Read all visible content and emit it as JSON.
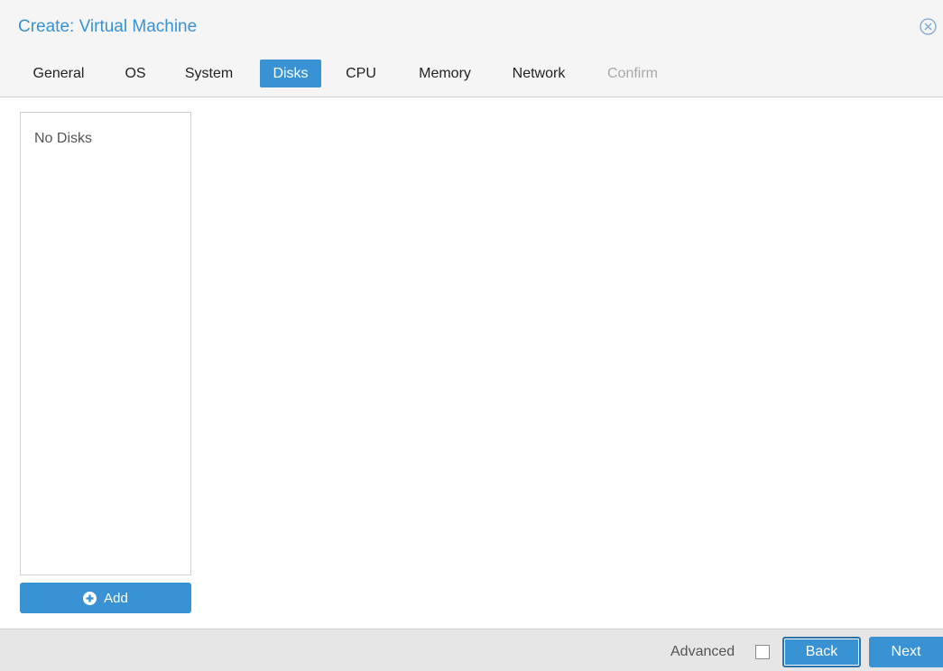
{
  "window": {
    "title": "Create: Virtual Machine"
  },
  "tabs": [
    {
      "label": "General",
      "state": "normal"
    },
    {
      "label": "OS",
      "state": "normal"
    },
    {
      "label": "System",
      "state": "normal"
    },
    {
      "label": "Disks",
      "state": "active"
    },
    {
      "label": "CPU",
      "state": "normal"
    },
    {
      "label": "Memory",
      "state": "normal"
    },
    {
      "label": "Network",
      "state": "normal"
    },
    {
      "label": "Confirm",
      "state": "disabled"
    }
  ],
  "disks": {
    "empty_text": "No Disks",
    "add_label": "Add"
  },
  "footer": {
    "advanced_label": "Advanced",
    "advanced_checked": false,
    "back_label": "Back",
    "next_label": "Next"
  },
  "colors": {
    "accent": "#3892d3",
    "footer_bg": "#e6e6e6"
  },
  "icons": {
    "close": "close-circle-icon",
    "add": "plus-circle-icon"
  }
}
